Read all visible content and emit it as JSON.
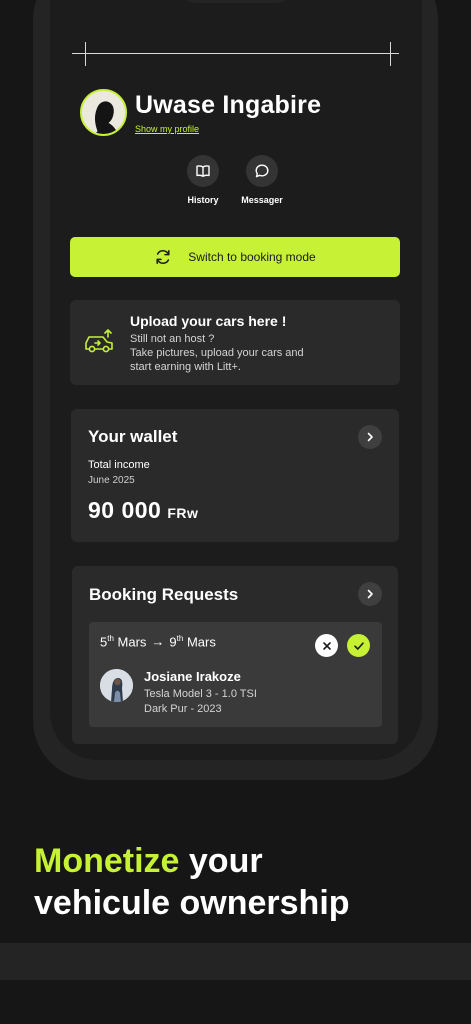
{
  "profile": {
    "name": "Uwase Ingabire",
    "profile_link": "Show my profile"
  },
  "quick_actions": [
    {
      "label": "History",
      "icon": "book-icon"
    },
    {
      "label": "Messager",
      "icon": "chat-bubble-icon"
    }
  ],
  "switch_button": {
    "label": "Switch to booking mode",
    "icon": "refresh-icon"
  },
  "upload_card": {
    "title": "Upload your cars here !",
    "lines": [
      "Still not an host ?",
      "Take pictures, upload your cars and",
      "start earning with Litt+."
    ],
    "icon": "car-upload-icon"
  },
  "wallet": {
    "title": "Your wallet",
    "label": "Total income",
    "period": "June 2025",
    "amount": "90 000",
    "currency": "FRw"
  },
  "bookings": {
    "title": "Booking Requests",
    "request": {
      "start_day": "5",
      "start_suffix": "th",
      "start_month": "Mars",
      "end_day": "9",
      "end_suffix": "th",
      "end_month": "Mars",
      "renter_name": "Josiane Irakoze",
      "car": "Tesla Model 3 - 1.0 TSI",
      "color_year": "Dark Pur - 2023"
    }
  },
  "headline": {
    "accent": "Monetize",
    "rest_line1": " your",
    "line2": "vehicule ownership"
  },
  "colors": {
    "accent": "#c6f135",
    "background": "#161616",
    "card": "#2a2a2a",
    "inner_card": "#3a3a3a"
  }
}
